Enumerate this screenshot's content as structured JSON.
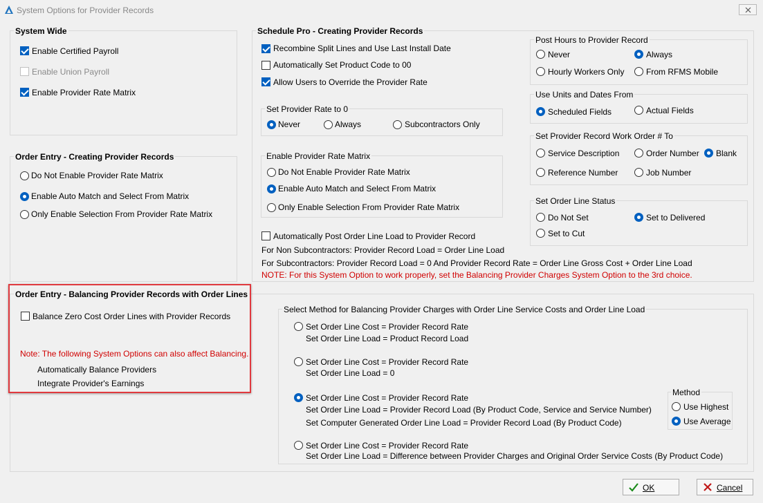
{
  "window": {
    "title": "System Options for Provider Records"
  },
  "system_wide": {
    "title": "System Wide",
    "items": [
      {
        "label": "Enable Certified Payroll",
        "checked": true,
        "enabled": true
      },
      {
        "label": "Enable Union Payroll",
        "checked": false,
        "enabled": false
      },
      {
        "label": "Enable Provider Rate Matrix",
        "checked": true,
        "enabled": true
      }
    ]
  },
  "order_entry_creating": {
    "title": "Order Entry - Creating Provider Records",
    "options": [
      {
        "label": "Do Not Enable Provider Rate Matrix",
        "selected": false
      },
      {
        "label": "Enable Auto Match and Select From Matrix",
        "selected": true
      },
      {
        "label": "Only Enable Selection From Provider Rate Matrix",
        "selected": false
      }
    ]
  },
  "schedule_pro": {
    "title": "Schedule Pro - Creating Provider Records",
    "checks": [
      {
        "label": "Recombine Split Lines and Use Last Install Date",
        "checked": true
      },
      {
        "label": "Automatically Set Product Code to 00",
        "checked": false
      },
      {
        "label": "Allow Users to Override the Provider Rate",
        "checked": true
      }
    ],
    "set_rate_zero": {
      "title": "Set Provider Rate to 0",
      "options": [
        {
          "label": "Never",
          "selected": true
        },
        {
          "label": "Always",
          "selected": false
        },
        {
          "label": "Subcontractors Only",
          "selected": false
        }
      ]
    },
    "enable_matrix": {
      "title": "Enable Provider Rate Matrix",
      "options": [
        {
          "label": "Do Not Enable Provider Rate Matrix",
          "selected": false
        },
        {
          "label": "Enable Auto Match and Select From Matrix",
          "selected": true
        },
        {
          "label": "Only Enable Selection From Provider Rate Matrix",
          "selected": false
        }
      ]
    },
    "auto_post": {
      "label": "Automatically Post Order Line Load to Provider Record",
      "checked": false
    },
    "notes": {
      "non_sub": "For Non Subcontractors:  Provider Record Load = Order Line Load",
      "sub": "For Subcontractors:  Provider Record Load = 0  And  Provider Record Rate = Order Line Gross Cost + Order Line Load",
      "warning": "NOTE:  For this System Option to work properly, set the Balancing Provider Charges System Option to the 3rd choice."
    }
  },
  "post_hours": {
    "title": "Post Hours to Provider Record",
    "options": [
      {
        "label": "Never",
        "selected": false
      },
      {
        "label": "Always",
        "selected": true
      },
      {
        "label": "Hourly Workers Only",
        "selected": false
      },
      {
        "label": "From RFMS Mobile",
        "selected": false
      }
    ]
  },
  "use_units": {
    "title": "Use Units and Dates From",
    "options": [
      {
        "label": "Scheduled Fields",
        "selected": true
      },
      {
        "label": "Actual Fields",
        "selected": false
      }
    ]
  },
  "work_order": {
    "title": "Set Provider Record Work Order # To",
    "options": [
      {
        "label": "Service Description",
        "selected": false
      },
      {
        "label": "Order Number",
        "selected": false
      },
      {
        "label": "Blank",
        "selected": true
      },
      {
        "label": "Reference Number",
        "selected": false
      },
      {
        "label": "Job Number",
        "selected": false
      }
    ]
  },
  "line_status": {
    "title": "Set Order Line Status",
    "options": [
      {
        "label": "Do Not Set",
        "selected": false
      },
      {
        "label": "Set to Delivered",
        "selected": true
      },
      {
        "label": "Set to Cut",
        "selected": false
      }
    ]
  },
  "balancing": {
    "title": "Order Entry - Balancing Provider Records with Order Lines",
    "check": {
      "label": "Balance Zero Cost Order Lines with Provider Records",
      "checked": false
    },
    "note": "Note:  The following System Options can also affect Balancing.",
    "related": [
      "Automatically Balance Providers",
      "Integrate Provider's Earnings"
    ],
    "method_group": {
      "title": "Select Method for Balancing Provider Charges with Order Line Service Costs and Order Line Load",
      "options": [
        {
          "selected": false,
          "lines": [
            "Set Order Line Cost = Provider Record Rate",
            "Set Order Line Load = Product Record Load"
          ]
        },
        {
          "selected": false,
          "lines": [
            "Set Order Line Cost = Provider Record Rate",
            "Set Order Line Load = 0"
          ]
        },
        {
          "selected": true,
          "lines": [
            "Set Order Line Cost = Provider Record Rate",
            "Set Order Line Load = Provider Record Load (By Product Code, Service and Service Number)",
            "Set Computer Generated Order Line Load = Provider Record Load (By Product Code)"
          ]
        },
        {
          "selected": false,
          "lines": [
            "Set Order Line Cost = Provider Record Rate",
            "Set Order Line Load = Difference between Provider Charges and Original Order Service Costs (By Product Code)"
          ]
        }
      ]
    },
    "method": {
      "title": "Method",
      "options": [
        {
          "label": "Use Highest",
          "selected": false
        },
        {
          "label": "Use Average",
          "selected": true
        }
      ]
    }
  },
  "buttons": {
    "ok": "OK",
    "cancel": "Cancel"
  },
  "colors": {
    "accent": "#0060c0",
    "warning": "#d00000",
    "highlight": "#e0393e"
  }
}
